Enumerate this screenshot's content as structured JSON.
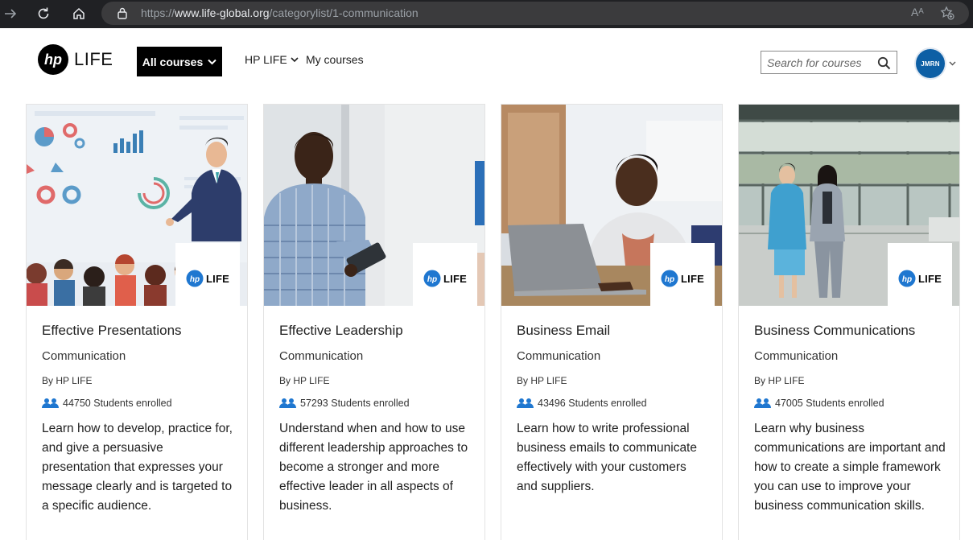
{
  "browser": {
    "url_prefix": "https://",
    "url_domain": "www.life-global.org",
    "url_path": "/categorylist/1-communication",
    "read_aloud_label": "Aᴬ"
  },
  "header": {
    "brand": "LIFE",
    "all_courses_label": "All courses",
    "nav_hplife_label": "HP LIFE",
    "nav_mycourses_label": "My courses",
    "search_placeholder": "Search for courses",
    "avatar_initials": "JMRN"
  },
  "colors": {
    "accent": "#0d5fa5",
    "icon_blue": "#1f77d0",
    "header_button": "#000000"
  },
  "badge_text": "LIFE",
  "courses": [
    {
      "title": "Effective Presentations",
      "category": "Communication",
      "author": "By HP LIFE",
      "students": "44750 Students enrolled",
      "description": "Learn how to develop, practice for, and give a persuasive presentation that expresses your message clearly and is targeted to a specific audience.",
      "image": "presentation-illustration"
    },
    {
      "title": "Effective Leadership",
      "category": "Communication",
      "author": "By HP LIFE",
      "students": "57293 Students enrolled",
      "description": "Understand when and how to use different leadership approaches to become a stronger and more effective leader in all aspects of business.",
      "image": "man-with-tablet-photo"
    },
    {
      "title": "Business Email",
      "category": "Communication",
      "author": "By HP LIFE",
      "students": "43496 Students enrolled",
      "description": "Learn how to write professional business emails to communicate effectively with your customers and suppliers.",
      "image": "laptop-student-photo"
    },
    {
      "title": "Business Communications",
      "category": "Communication",
      "author": "By HP LIFE",
      "students": "47005 Students enrolled",
      "description": "Learn why business communications are important and how to create a simple framework you can use to improve your business communication skills.",
      "image": "two-women-walking-photo"
    }
  ]
}
